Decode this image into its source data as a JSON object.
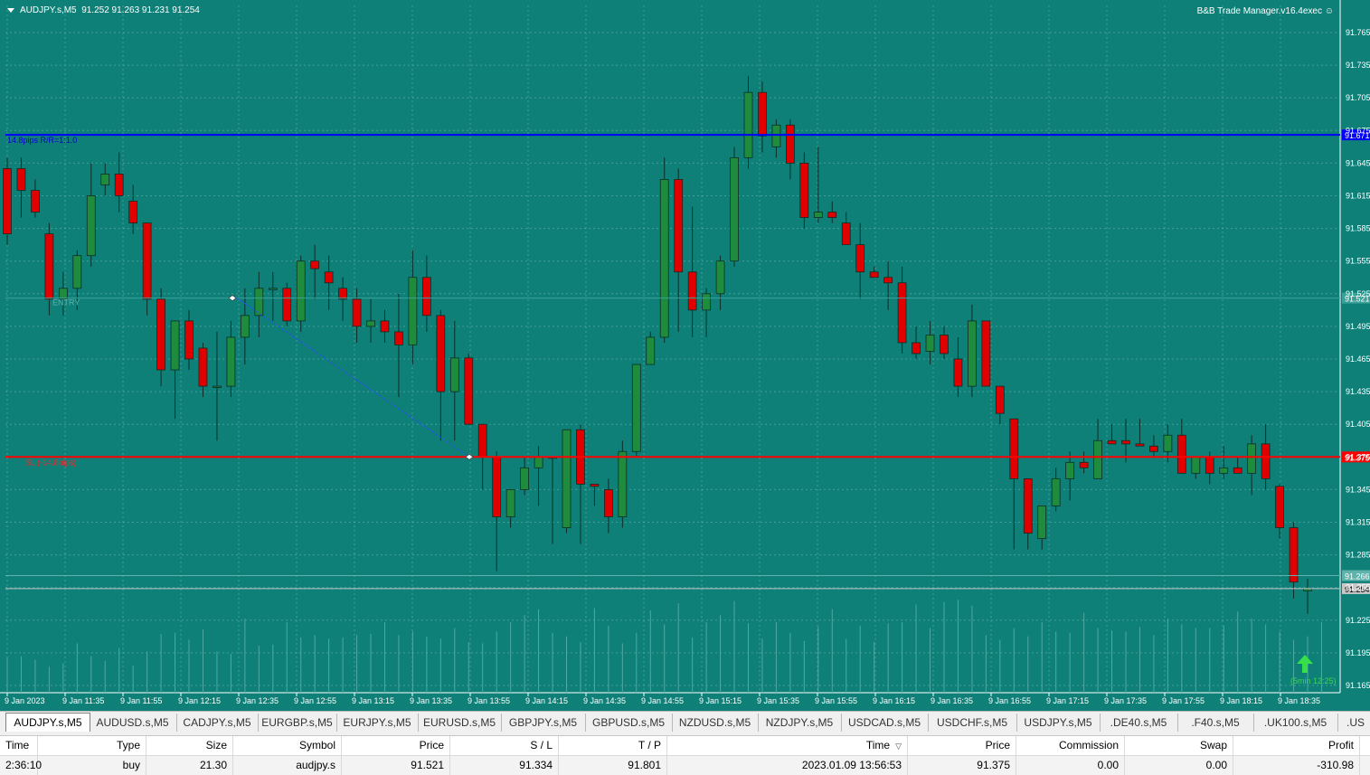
{
  "chart_header": {
    "symbol": "AUDJPY.s,M5",
    "ohlc": "91.252 91.263 91.231 91.254"
  },
  "ea_label": "B&B Trade Manager.v16.4exec",
  "chart_data": {
    "type": "candlestick",
    "price_axis": [
      "91.765",
      "91.735",
      "91.705",
      "91.675",
      "91.645",
      "91.615",
      "91.585",
      "91.555",
      "91.525",
      "91.495",
      "91.465",
      "91.435",
      "91.405",
      "91.375",
      "91.345",
      "91.315",
      "91.285",
      "91.255",
      "91.225",
      "91.195",
      "91.165"
    ],
    "time_axis": [
      "9 Jan 2023",
      "9 Jan 11:35",
      "9 Jan 11:55",
      "9 Jan 12:15",
      "9 Jan 12:35",
      "9 Jan 12:55",
      "9 Jan 13:15",
      "9 Jan 13:35",
      "9 Jan 13:55",
      "9 Jan 14:15",
      "9 Jan 14:35",
      "9 Jan 14:55",
      "9 Jan 15:15",
      "9 Jan 15:35",
      "9 Jan 15:55",
      "9 Jan 16:15",
      "9 Jan 16:35",
      "9 Jan 16:55",
      "9 Jan 17:15",
      "9 Jan 17:35",
      "9 Jan 17:55",
      "9 Jan 18:15",
      "9 Jan 18:35"
    ],
    "ylim": [
      91.165,
      91.765
    ],
    "colors": {
      "background": "#0f8078",
      "bull": "#1e8c3c",
      "bear": "#e00000",
      "wick": "#0a2d28"
    },
    "candles": [
      [
        91.64,
        91.65,
        91.57,
        91.58
      ],
      [
        91.64,
        91.65,
        91.595,
        91.62
      ],
      [
        91.62,
        91.63,
        91.595,
        91.6
      ],
      [
        91.58,
        91.59,
        91.505,
        91.52
      ],
      [
        91.52,
        91.545,
        91.505,
        91.53
      ],
      [
        91.53,
        91.565,
        91.51,
        91.56
      ],
      [
        91.56,
        91.645,
        91.55,
        91.615
      ],
      [
        91.625,
        91.645,
        91.615,
        91.635
      ],
      [
        91.635,
        91.655,
        91.6,
        91.615
      ],
      [
        91.61,
        91.625,
        91.58,
        91.59
      ],
      [
        91.59,
        91.59,
        91.505,
        91.52
      ],
      [
        91.52,
        91.53,
        91.44,
        91.455
      ],
      [
        91.455,
        91.5,
        91.41,
        91.5
      ],
      [
        91.5,
        91.51,
        91.455,
        91.465
      ],
      [
        91.475,
        91.48,
        91.43,
        91.44
      ],
      [
        91.44,
        91.49,
        91.39,
        91.44
      ],
      [
        91.44,
        91.5,
        91.43,
        91.485
      ],
      [
        91.485,
        91.53,
        91.46,
        91.505
      ],
      [
        91.505,
        91.545,
        91.485,
        91.53
      ],
      [
        91.53,
        91.545,
        91.5,
        91.53
      ],
      [
        91.53,
        91.535,
        91.495,
        91.5
      ],
      [
        91.5,
        91.56,
        91.49,
        91.555
      ],
      [
        91.555,
        91.57,
        91.52,
        91.548
      ],
      [
        91.545,
        91.56,
        91.51,
        91.535
      ],
      [
        91.53,
        91.54,
        91.5,
        91.52
      ],
      [
        91.52,
        91.53,
        91.48,
        91.495
      ],
      [
        91.495,
        91.52,
        91.48,
        91.5
      ],
      [
        91.5,
        91.51,
        91.48,
        91.49
      ],
      [
        91.49,
        91.525,
        91.43,
        91.478
      ],
      [
        91.478,
        91.565,
        91.46,
        91.54
      ],
      [
        91.54,
        91.56,
        91.49,
        91.505
      ],
      [
        91.505,
        91.51,
        91.39,
        91.435
      ],
      [
        91.435,
        91.5,
        91.39,
        91.466
      ],
      [
        91.466,
        91.47,
        91.405,
        91.405
      ],
      [
        91.405,
        91.405,
        91.345,
        91.375
      ],
      [
        91.375,
        91.38,
        91.27,
        91.32
      ],
      [
        91.32,
        91.345,
        91.31,
        91.345
      ],
      [
        91.345,
        91.375,
        91.34,
        91.365
      ],
      [
        91.365,
        91.385,
        91.33,
        91.375
      ],
      [
        91.375,
        91.375,
        91.295,
        91.375
      ],
      [
        91.31,
        91.395,
        91.305,
        91.4
      ],
      [
        91.4,
        91.405,
        91.295,
        91.35
      ],
      [
        91.35,
        91.35,
        91.33,
        91.348
      ],
      [
        91.345,
        91.355,
        91.305,
        91.32
      ],
      [
        91.32,
        91.39,
        91.31,
        91.38
      ],
      [
        91.38,
        91.45,
        91.375,
        91.46
      ],
      [
        91.46,
        91.49,
        91.46,
        91.485
      ],
      [
        91.485,
        91.65,
        91.48,
        91.63
      ],
      [
        91.63,
        91.64,
        91.49,
        91.545
      ],
      [
        91.545,
        91.605,
        91.485,
        91.51
      ],
      [
        91.51,
        91.53,
        91.485,
        91.525
      ],
      [
        91.525,
        91.56,
        91.51,
        91.555
      ],
      [
        91.555,
        91.66,
        91.55,
        91.65
      ],
      [
        91.65,
        91.725,
        91.64,
        91.71
      ],
      [
        91.71,
        91.72,
        91.655,
        91.67
      ],
      [
        91.66,
        91.685,
        91.65,
        91.68
      ],
      [
        91.68,
        91.685,
        91.63,
        91.645
      ],
      [
        91.645,
        91.655,
        91.585,
        91.595
      ],
      [
        91.595,
        91.66,
        91.59,
        91.6
      ],
      [
        91.6,
        91.61,
        91.59,
        91.595
      ],
      [
        91.59,
        91.6,
        91.57,
        91.57
      ],
      [
        91.57,
        91.59,
        91.52,
        91.545
      ],
      [
        91.545,
        91.55,
        91.54,
        91.54
      ],
      [
        91.54,
        91.555,
        91.51,
        91.535
      ],
      [
        91.535,
        91.55,
        91.47,
        91.48
      ],
      [
        91.48,
        91.495,
        91.465,
        91.47
      ],
      [
        91.472,
        91.5,
        91.46,
        91.487
      ],
      [
        91.487,
        91.495,
        91.465,
        91.47
      ],
      [
        91.465,
        91.485,
        91.43,
        91.44
      ],
      [
        91.44,
        91.515,
        91.43,
        91.5
      ],
      [
        91.5,
        91.5,
        91.44,
        91.44
      ],
      [
        91.44,
        91.44,
        91.405,
        91.415
      ],
      [
        91.41,
        91.41,
        91.29,
        91.355
      ],
      [
        91.355,
        91.355,
        91.29,
        91.305
      ],
      [
        91.3,
        91.33,
        91.29,
        91.33
      ],
      [
        91.33,
        91.365,
        91.325,
        91.355
      ],
      [
        91.355,
        91.38,
        91.335,
        91.37
      ],
      [
        91.37,
        91.38,
        91.36,
        91.365
      ],
      [
        91.355,
        91.41,
        91.355,
        91.39
      ],
      [
        91.39,
        91.405,
        91.39,
        91.387
      ],
      [
        91.39,
        91.41,
        91.37,
        91.387
      ],
      [
        91.387,
        91.41,
        91.385,
        91.385
      ],
      [
        91.385,
        91.395,
        91.375,
        91.38
      ],
      [
        91.38,
        91.405,
        91.37,
        91.395
      ],
      [
        91.395,
        91.41,
        91.38,
        91.36
      ],
      [
        91.36,
        91.375,
        91.355,
        91.375
      ],
      [
        91.375,
        91.38,
        91.35,
        91.36
      ],
      [
        91.36,
        91.385,
        91.355,
        91.365
      ],
      [
        91.365,
        91.375,
        91.36,
        91.36
      ],
      [
        91.36,
        91.395,
        91.34,
        91.387
      ],
      [
        91.387,
        91.405,
        91.345,
        91.355
      ],
      [
        91.348,
        91.35,
        91.3,
        91.31
      ],
      [
        91.31,
        91.315,
        91.245,
        91.26
      ],
      [
        91.252,
        91.263,
        91.231,
        91.254
      ]
    ],
    "volumes": [
      30,
      31,
      28,
      22,
      25,
      42,
      31,
      27,
      38,
      23,
      35,
      50,
      51,
      45,
      54,
      35,
      33,
      63,
      40,
      41,
      60,
      47,
      49,
      46,
      47,
      49,
      50,
      60,
      49,
      52,
      48,
      46,
      55,
      43,
      42,
      52,
      60,
      66,
      71,
      51,
      48,
      43,
      72,
      57,
      42,
      51,
      70,
      58,
      76,
      47,
      60,
      66,
      78,
      59,
      46,
      60,
      51,
      44,
      56,
      71,
      46,
      57,
      43,
      59,
      60,
      75,
      55,
      77,
      79,
      74,
      49,
      45,
      55,
      48,
      60,
      52,
      51,
      68,
      55,
      53,
      52,
      56,
      49,
      63,
      58,
      55,
      55,
      57,
      69,
      63,
      58,
      52,
      45,
      48,
      60
    ],
    "lines": [
      {
        "name": "tp",
        "label": "14.8pips R/R=1:1.0",
        "price": 91.671,
        "tag": "91.671",
        "color": "#0000ff"
      },
      {
        "name": "sl",
        "label": "SL (-14.8pips)",
        "price": 91.375,
        "tag": "91.375",
        "color": "#ff0000"
      },
      {
        "name": "bid",
        "price": 91.254,
        "tag": "91.254",
        "color": "#c8c8c8"
      },
      {
        "name": "ask",
        "price": 91.266,
        "tag": "91.266",
        "color": "#5fb3ad"
      },
      {
        "name": "entry",
        "label": "ENTRY",
        "price": 91.521,
        "tag": "91.521",
        "color": "#3aa198"
      }
    ],
    "timer_label": "(5min 12:25)"
  },
  "tabs": [
    {
      "label": "AUDJPY.s,M5",
      "active": true
    },
    {
      "label": "AUDUSD.s,M5"
    },
    {
      "label": "CADJPY.s,M5"
    },
    {
      "label": "EURGBP.s,M5"
    },
    {
      "label": "EURJPY.s,M5"
    },
    {
      "label": "EURUSD.s,M5"
    },
    {
      "label": "GBPJPY.s,M5"
    },
    {
      "label": "GBPUSD.s,M5"
    },
    {
      "label": "NZDUSD.s,M5"
    },
    {
      "label": "NZDJPY.s,M5"
    },
    {
      "label": "USDCAD.s,M5"
    },
    {
      "label": "USDCHF.s,M5"
    },
    {
      "label": "USDJPY.s,M5"
    },
    {
      "label": ".DE40.s,M5"
    },
    {
      "label": ".F40.s,M5"
    },
    {
      "label": ".UK100.s,M5"
    },
    {
      "label": ".US"
    }
  ],
  "table": {
    "columns": [
      "Time",
      "Type",
      "Size",
      "Symbol",
      "Price",
      "S / L",
      "T / P",
      "Time",
      "Price",
      "Commission",
      "Swap",
      "Profit"
    ],
    "sort_indicator": "▽",
    "row": [
      "2:36:10",
      "buy",
      "21.30",
      "audjpy.s",
      "91.521",
      "91.334",
      "91.801",
      "2023.01.09 13:56:53",
      "91.375",
      "0.00",
      "0.00",
      "-310.98"
    ]
  }
}
